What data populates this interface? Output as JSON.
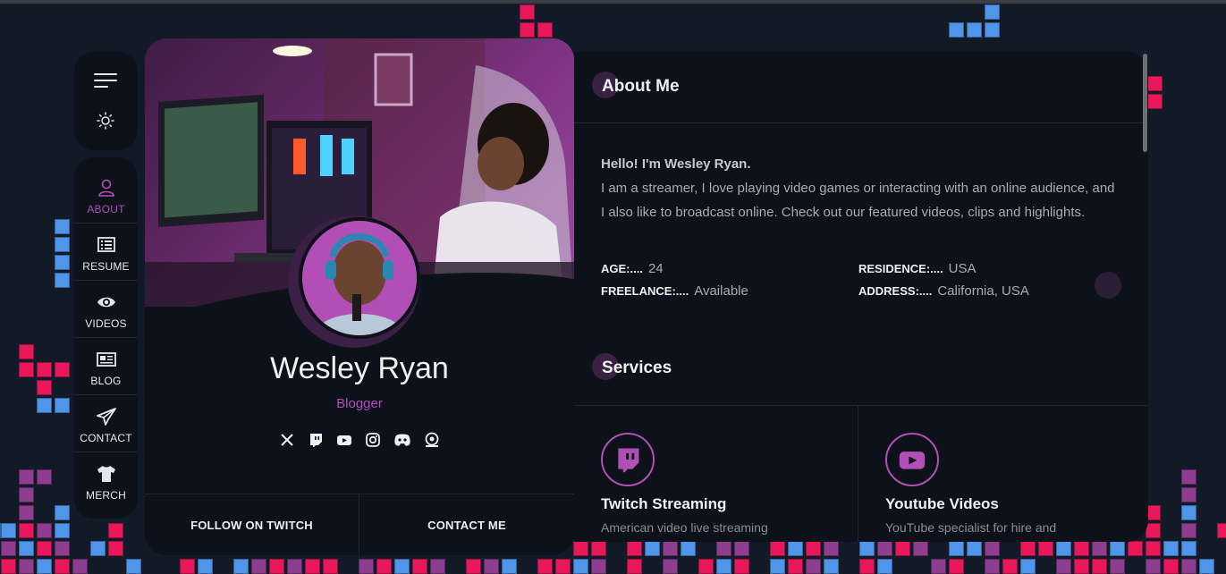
{
  "nav": {
    "items": [
      {
        "label": "ABOUT",
        "icon": "user-icon",
        "active": true
      },
      {
        "label": "RESUME",
        "icon": "list-icon",
        "active": false
      },
      {
        "label": "VIDEOS",
        "icon": "eye-icon",
        "active": false
      },
      {
        "label": "BLOG",
        "icon": "newspaper-icon",
        "active": false
      },
      {
        "label": "CONTACT",
        "icon": "paper-plane-icon",
        "active": false
      },
      {
        "label": "MERCH",
        "icon": "tshirt-icon",
        "active": false
      }
    ]
  },
  "profile": {
    "name": "Wesley Ryan",
    "role": "Blogger",
    "socials": [
      "x-icon",
      "twitch-icon",
      "youtube-icon",
      "instagram-icon",
      "discord-icon",
      "steam-icon"
    ],
    "buttons": {
      "follow": "FOLLOW ON TWITCH",
      "contact": "CONTACT ME"
    }
  },
  "about": {
    "title_first": "A",
    "title_rest": "bout Me",
    "hello": "Hello! I'm Wesley Ryan.",
    "text": "I am a streamer, I love playing video games or interacting with an online audience, and I also like to broadcast online. Check out our featured videos, clips and highlights.",
    "info": [
      {
        "key": "AGE:....",
        "value": "24"
      },
      {
        "key": "RESIDENCE:....",
        "value": "USA"
      },
      {
        "key": "FREELANCE:....",
        "value": "Available"
      },
      {
        "key": "ADDRESS:....",
        "value": "California, USA"
      }
    ]
  },
  "services": {
    "title_first": "S",
    "title_rest": "ervices",
    "items": [
      {
        "title": "Twitch Streaming",
        "desc": "American video live streaming",
        "icon": "twitch-icon"
      },
      {
        "title": "Youtube Videos",
        "desc": "YouTube specialist for hire and",
        "icon": "youtube-icon"
      }
    ]
  },
  "colors": {
    "accent": "#b14fb6",
    "background": "#111a26",
    "panel": "#0c111a"
  }
}
